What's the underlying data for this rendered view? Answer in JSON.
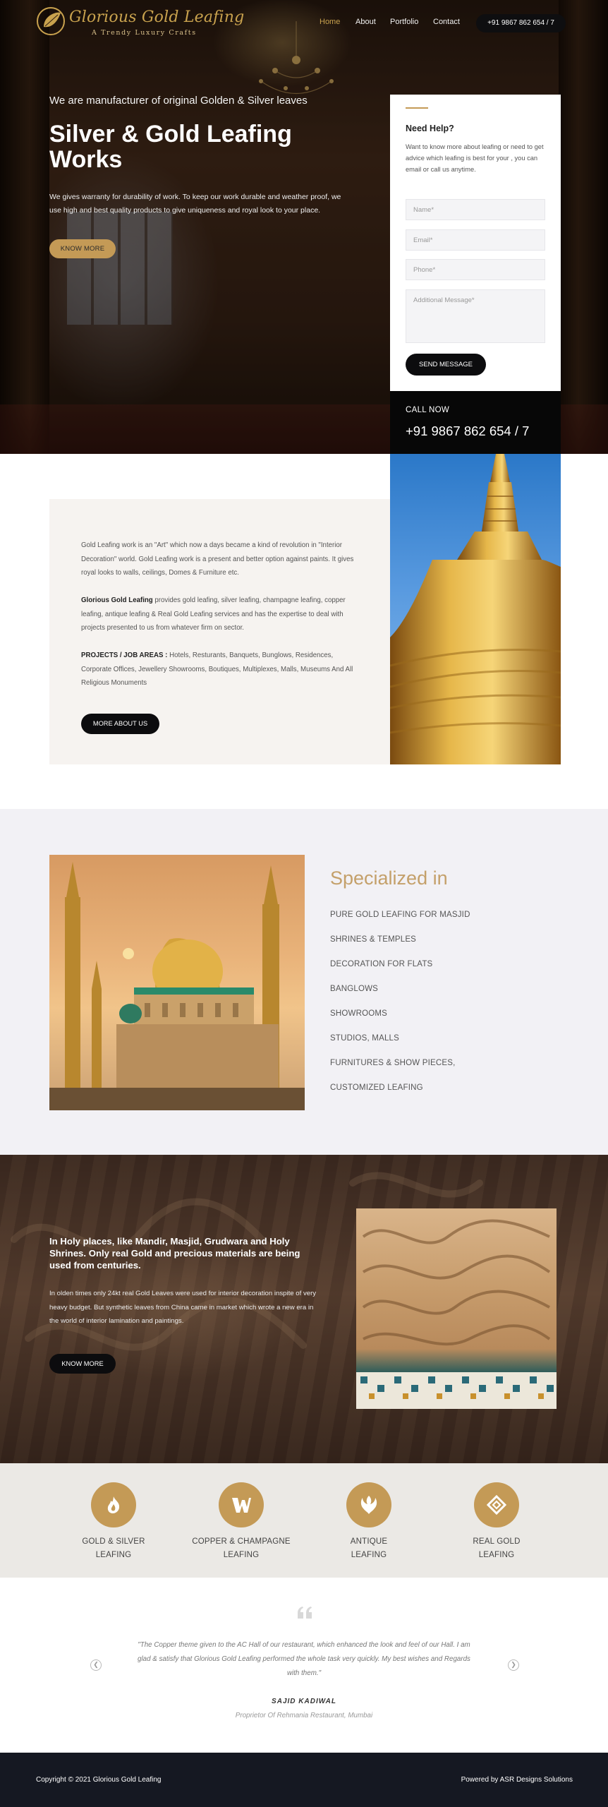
{
  "brand": {
    "name": "Glorious Gold Leafing",
    "tagline": "A Trendy Luxury Crafts"
  },
  "nav": {
    "items": [
      "Home",
      "About",
      "Portfolio",
      "Contact"
    ],
    "active": "Home",
    "phone": "+91 9867 862 654 / 7"
  },
  "hero": {
    "kicker": "We are manufacturer of original Golden & Silver leaves",
    "title": "Silver & Gold Leafing Works",
    "description": "We gives warranty for durability of work. To keep our work durable and weather proof, we use high and best quality products to give uniqueness and royal look to your place.",
    "cta": "KNOW MORE"
  },
  "help_form": {
    "title": "Need Help?",
    "description": "Want to know more about leafing or need to get advice which leafing is best for your , you can email or call us anytime.",
    "fields": {
      "name": "Name*",
      "email": "Email*",
      "phone": "Phone*",
      "message": "Additional Message*"
    },
    "submit": "SEND MESSAGE",
    "call_label": "CALL NOW",
    "call_number": "+91 9867 862 654 / 7"
  },
  "about": {
    "p1": "Gold Leafing work is an \"Art\" which now a days became a kind of revolution in \"Interior Decoration\" world. Gold Leafing work is a present and better option against paints. It gives royal looks to walls, ceilings, Domes & Furniture etc.",
    "p2_bold": "Glorious Gold Leafing",
    "p2": " provides gold leafing, silver leafing, champagne leafing, copper leafing, antique leafing & Real Gold Leafing services and has the expertise to deal with projects presented to us from whatever firm on sector.",
    "p3_bold": "PROJECTS / JOB AREAS :",
    "p3": " Hotels, Resturants, Banquets, Bunglows, Residences, Corporate Offices, Jewellery Showrooms, Boutiques, Multiplexes, Malls, Museums And All Religious Monuments",
    "cta": "MORE ABOUT US"
  },
  "specialized": {
    "title": "Specialized in",
    "items": [
      "PURE GOLD LEAFING FOR MASJID",
      "SHRINES & TEMPLES",
      "DECORATION FOR FLATS",
      "BANGLOWS",
      "SHOWROOMS",
      "STUDIOS, MALLS",
      "FURNITURES & SHOW PIECES,",
      "CUSTOMIZED LEAFING"
    ]
  },
  "holy": {
    "title": "In Holy places, like Mandir, Masjid, Grudwara and Holy Shrines. Only real Gold and precious materials are being used from centuries.",
    "description": "In olden times only 24kt real Gold Leaves were used for interior decoration inspite of very heavy budget. But synthetic leaves from China came in market which wrote a new era in the world of interior lamination and paintings.",
    "cta": "KNOW MORE"
  },
  "services": [
    {
      "line1": "GOLD & SILVER",
      "line2": "LEAFING",
      "icon": "fire-icon"
    },
    {
      "line1": "COPPER & CHAMPAGNE",
      "line2": "LEAFING",
      "icon": "shield-w-icon"
    },
    {
      "line1": "ANTIQUE",
      "line2": "LEAFING",
      "icon": "rebel-emblem-icon"
    },
    {
      "line1": "REAL GOLD",
      "line2": "LEAFING",
      "icon": "diamond-link-icon"
    }
  ],
  "testimonial": {
    "quote": "\"The Copper theme given to the AC Hall of our restaurant, which enhanced the look and feel of our Hall. I am glad & satisfy that Glorious Gold Leafing performed the whole task very quickly. My best wishes and Regards with them.\"",
    "name": "SAJID KADIWAL",
    "role": "Proprietor Of Rehmania Restaurant, Mumbai"
  },
  "footer": {
    "copyright": "Copyright © 2021 Glorious Gold Leafing",
    "powered": "Powered by ASR Designs Solutions"
  },
  "colors": {
    "gold": "#c49a56",
    "dark": "#0c0c0e",
    "footer": "#151822"
  }
}
